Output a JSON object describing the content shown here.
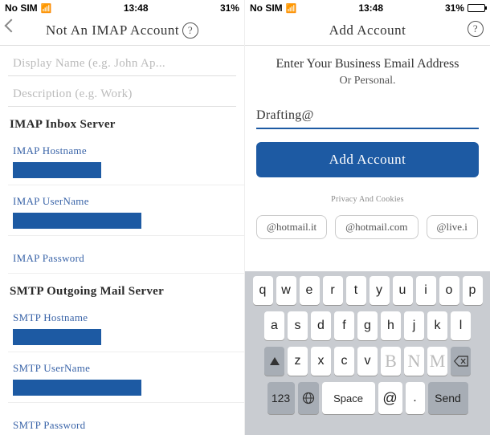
{
  "left": {
    "status": {
      "carrier": "No SIM",
      "time": "13:48",
      "battery": "31%"
    },
    "nav": {
      "title": "Not An IMAP Account"
    },
    "fields": {
      "display_name_ph": "Display Name (e.g. John Ap...",
      "description_ph": "Description (e.g. Work)"
    },
    "imap": {
      "header": "IMAP Inbox Server",
      "host_lbl": "IMAP Hostname",
      "user_lbl": "IMAP UserName",
      "pass_lbl": "IMAP Password"
    },
    "smtp": {
      "header": "SMTP Outgoing Mail Server",
      "host_lbl": "SMTP Hostname",
      "user_lbl": "SMTP UserName",
      "pass_lbl": "SMTP Password"
    }
  },
  "right": {
    "status": {
      "carrier": "No SIM",
      "time": "13:48",
      "battery": "31%"
    },
    "nav": {
      "title": "Add Account"
    },
    "heading": "Enter Your Business Email Address",
    "sub": "Or Personal.",
    "email_value": "Drafting@",
    "add_btn": "Add Account",
    "privacy": "Privacy And Cookies",
    "chips": [
      "@hotmail.it",
      "@hotmail.com",
      "@live.i"
    ],
    "kbd": {
      "r1": [
        "q",
        "w",
        "e",
        "r",
        "t",
        "y",
        "u",
        "i",
        "o",
        "p"
      ],
      "r2": [
        "a",
        "s",
        "d",
        "f",
        "g",
        "h",
        "j",
        "k",
        "l"
      ],
      "r3": [
        "z",
        "x",
        "c",
        "v",
        "B",
        "N",
        "M"
      ],
      "num": "123",
      "space": "Space",
      "at": "@",
      "dot": ".",
      "send": "Send"
    }
  }
}
